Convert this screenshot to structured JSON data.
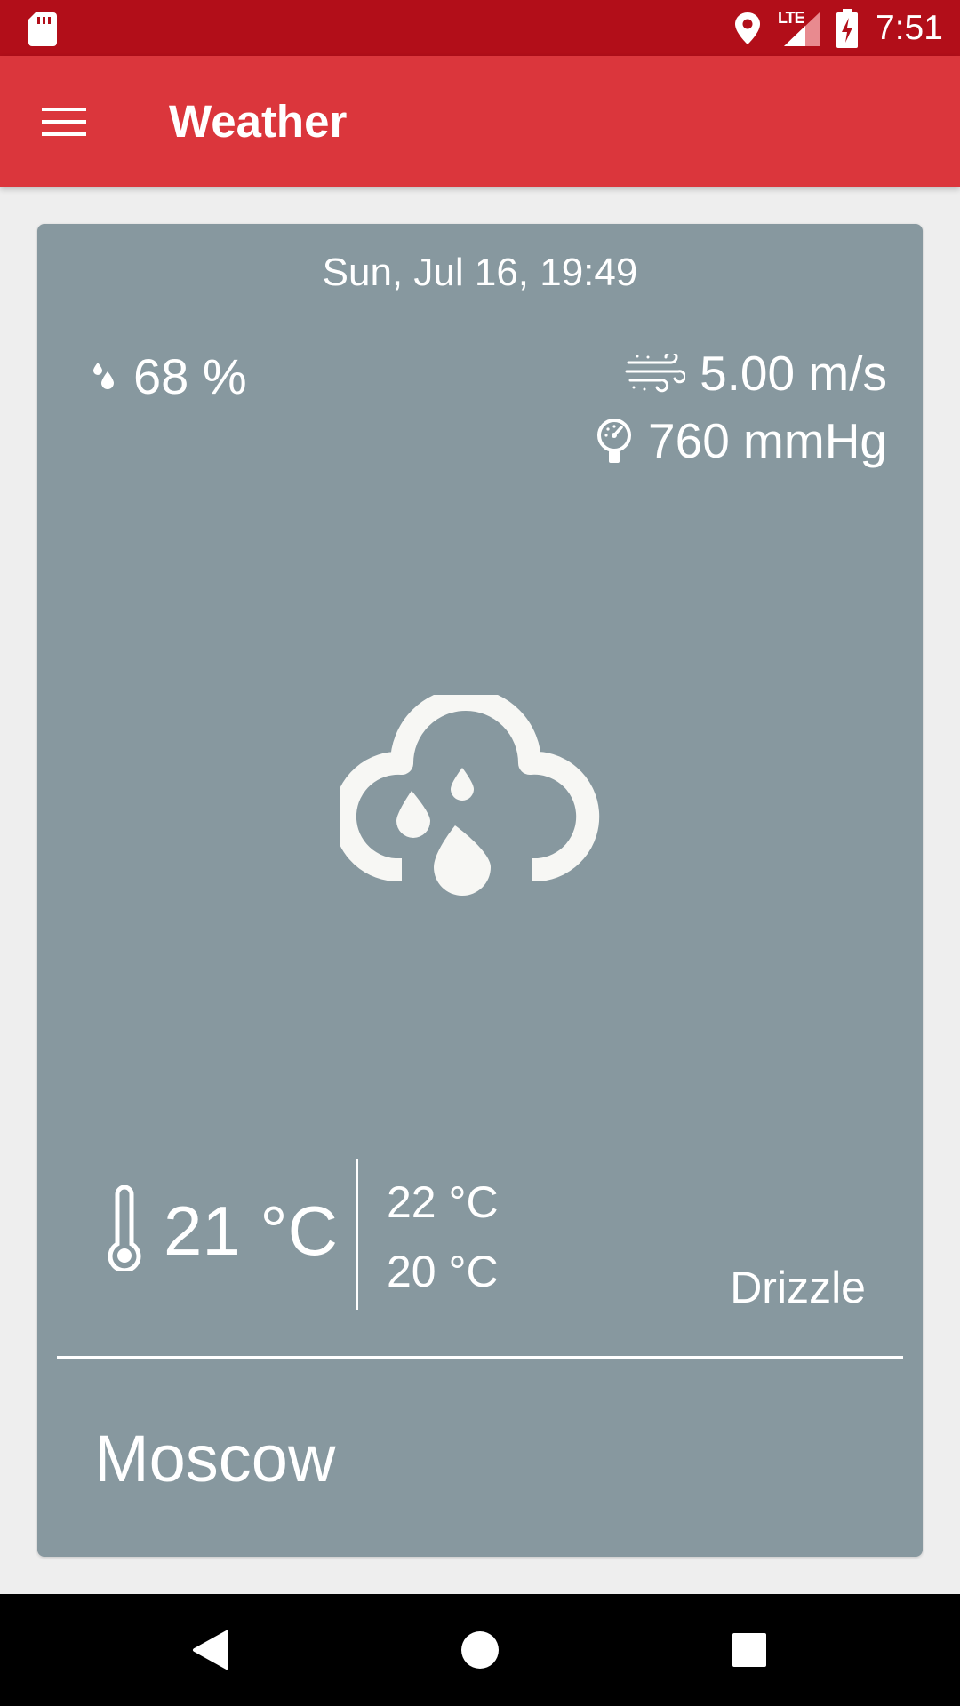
{
  "status_bar": {
    "network_label": "LTE",
    "time": "7:51",
    "icons": [
      "sd-card-icon",
      "location-icon",
      "signal-icon",
      "battery-charging-icon"
    ]
  },
  "app_bar": {
    "title": "Weather",
    "menu_icon": "menu-icon"
  },
  "weather": {
    "date": "Sun, Jul 16, 19:49",
    "humidity": "68 %",
    "wind": "5.00 m/s",
    "pressure": "760 mmHg",
    "condition_icon": "drizzle-icon",
    "temperature": "21 °C",
    "temp_max": "22 °C",
    "temp_min": "20 °C",
    "condition": "Drizzle",
    "city": "Moscow"
  },
  "nav_bar": {
    "icons": [
      "back-icon",
      "home-icon",
      "recents-icon"
    ]
  },
  "colors": {
    "status_bar": "#b20e19",
    "app_bar": "#db363c",
    "card": "#87989f",
    "background": "#eeeeee",
    "icon_fill": "#f7f7f4"
  }
}
